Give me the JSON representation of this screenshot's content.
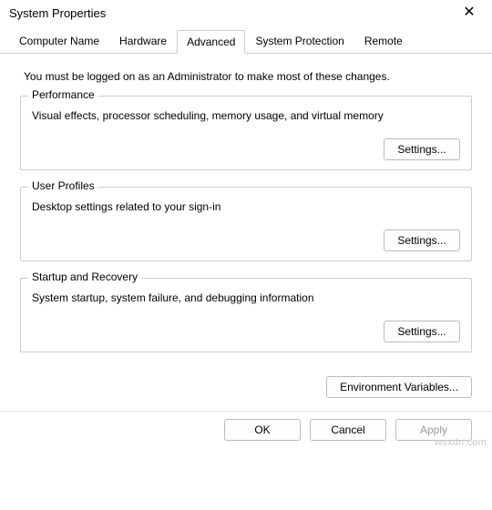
{
  "window": {
    "title": "System Properties",
    "close_glyph": "✕"
  },
  "tabs": {
    "computer_name": "Computer Name",
    "hardware": "Hardware",
    "advanced": "Advanced",
    "system_protection": "System Protection",
    "remote": "Remote"
  },
  "intro": "You must be logged on as an Administrator to make most of these changes.",
  "groups": {
    "performance": {
      "legend": "Performance",
      "desc": "Visual effects, processor scheduling, memory usage, and virtual memory",
      "button": "Settings..."
    },
    "user_profiles": {
      "legend": "User Profiles",
      "desc": "Desktop settings related to your sign-in",
      "button": "Settings..."
    },
    "startup_recovery": {
      "legend": "Startup and Recovery",
      "desc": "System startup, system failure, and debugging information",
      "button": "Settings..."
    }
  },
  "env_button": "Environment Variables...",
  "footer": {
    "ok": "OK",
    "cancel": "Cancel",
    "apply": "Apply"
  },
  "watermark": "wsxdn.com"
}
